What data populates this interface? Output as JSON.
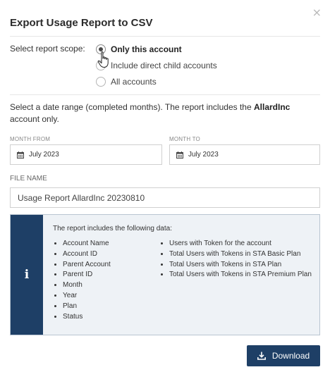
{
  "dialog": {
    "title": "Export Usage Report to CSV",
    "close_glyph": "×"
  },
  "scope": {
    "label": "Select report scope:",
    "options": [
      {
        "label": "Only this account",
        "checked": true
      },
      {
        "label": "Include direct child accounts",
        "checked": false
      },
      {
        "label": "All accounts",
        "checked": false
      }
    ]
  },
  "range": {
    "text_before": "Select a date range (completed months). The report includes the ",
    "account_name": "AllardInc",
    "text_after": " account only."
  },
  "month_from": {
    "label": "MONTH FROM",
    "value": "July 2023",
    "icon": "calendar-icon"
  },
  "month_to": {
    "label": "MONTH TO",
    "value": "July 2023",
    "icon": "calendar-icon"
  },
  "file_name": {
    "label": "FILE NAME",
    "value": "Usage Report AllardInc 20230810"
  },
  "info_panel": {
    "icon_glyph": "i",
    "intro": "The report includes the following data:",
    "col1": [
      "Account Name",
      "Account ID",
      "Parent Account",
      "Parent ID",
      "Month",
      "Year",
      "Plan",
      "Status"
    ],
    "col2": [
      "Users with Token for the account",
      "Total Users with Tokens in STA Basic Plan",
      "Total Users with Tokens in STA Plan",
      "Total Users with Tokens in STA Premium Plan"
    ]
  },
  "download_button": {
    "label": "Download",
    "icon": "download-icon"
  },
  "colors": {
    "primary": "#1e3f66",
    "info_bg": "#eef2f6",
    "border": "#d0d0d0"
  }
}
